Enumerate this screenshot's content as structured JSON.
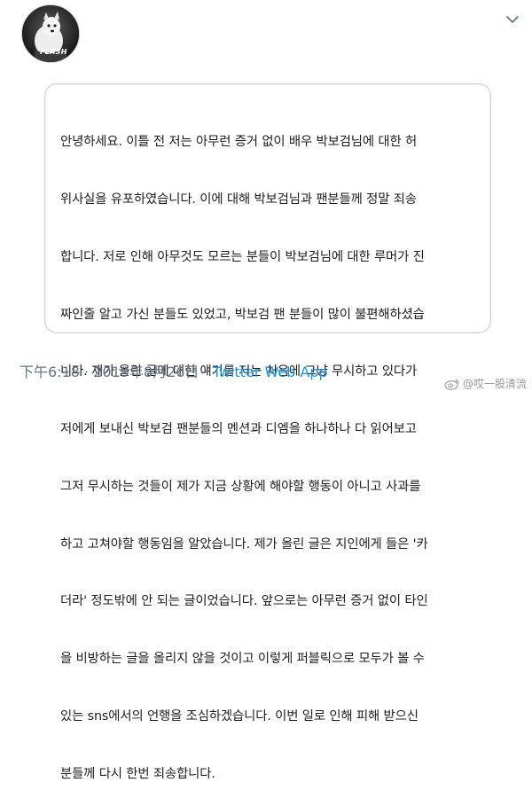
{
  "profile": {
    "avatar_text": "FLASH",
    "caret_icon": "chevron-down-icon"
  },
  "tweet": {
    "lines": [
      "안녕하세요. 이틀 전 저는 아무런 증거 없이 배우 박보검님에 대한 허",
      "위사실을 유포하였습니다. 이에 대해 박보검님과 팬분들께 정말 죄송",
      "합니다. 저로 인해 아무것도 모르는 분들이 박보검님에 대한 루머가 진",
      "짜인줄 알고 가신 분들도 있었고, 박보검 팬 분들이 많이 불편해하셨습",
      "니다. 제가 올린 글에 대한 얘기를 저는 처음에 그냥 무시하고 있다가",
      "저에게 보내신 박보검 팬분들의 멘션과 디엠을 하나하나 다 읽어보고",
      "그저 무시하는 것들이 제가 지금 상황에 해야할 행동이 아니고 사과를",
      "하고 고쳐야할 행동임을 알았습니다. 제가 올린 글은 지인에게 들은 '카",
      "더라' 정도밖에 안 되는 글이었습니다. 앞으로는 아무런 증거 없이 타인",
      "을 비방하는 글을 올리지 않을 것이고 이렇게 퍼블릭으로 모두가 볼 수",
      "있는 sns에서의 언행을 조심하겠습니다. 이번 일로 인해 피해 받으신",
      "분들께 다시 한번 죄송합니다."
    ]
  },
  "meta": {
    "time": "下午6:18",
    "separator": " · ",
    "date": "2019年8月26日",
    "source": "Twitter Web App"
  },
  "watermark": {
    "text": "@哎一股清流",
    "icon": "weibo-icon"
  }
}
